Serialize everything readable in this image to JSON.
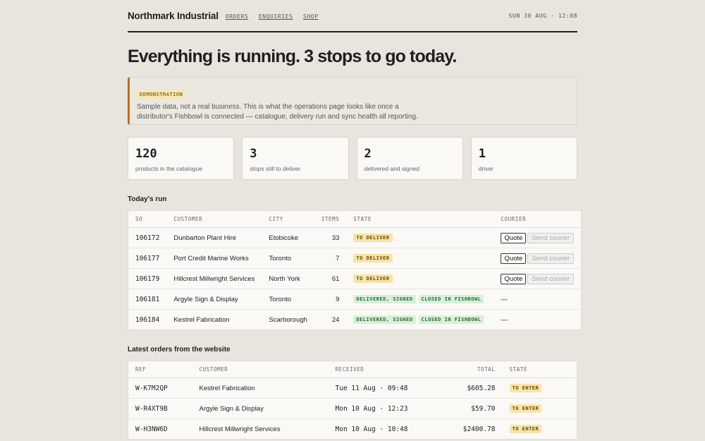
{
  "header": {
    "brand": "Northmark Industrial",
    "nav": [
      "ORDERS",
      "ENQUIRIES",
      "SHOP"
    ],
    "datetime": "SUN 30 AUG · 12:08"
  },
  "headline": "Everything is running. 3 stops to go today.",
  "demo": {
    "badge": "DEMONSTRATION",
    "text": "Sample data, not a real business. This is what the operations page looks like once a distributor's Fishbowl is connected — catalogue, delivery run and sync health all reporting."
  },
  "stats": [
    {
      "value": "120",
      "label": "products in the catalogue"
    },
    {
      "value": "3",
      "label": "stops still to deliver"
    },
    {
      "value": "2",
      "label": "delivered and signed"
    },
    {
      "value": "1",
      "label": "driver"
    }
  ],
  "run": {
    "title": "Today's run",
    "headers": [
      "SO",
      "CUSTOMER",
      "CITY",
      "ITEMS",
      "STATE",
      "COURIER"
    ],
    "quote_label": "Quote",
    "send_label": "Send courier",
    "dash": "—",
    "rows": [
      {
        "so": "106172",
        "customer": "Dunbarton Plant Hire",
        "city": "Etobicoke",
        "items": "33",
        "states": [
          "TO DELIVER"
        ],
        "courier": true
      },
      {
        "so": "106177",
        "customer": "Port Credit Marine Works",
        "city": "Toronto",
        "items": "7",
        "states": [
          "TO DELIVER"
        ],
        "courier": true
      },
      {
        "so": "106179",
        "customer": "Hillcrest Millwright Services",
        "city": "North York",
        "items": "61",
        "states": [
          "TO DELIVER"
        ],
        "courier": true
      },
      {
        "so": "106181",
        "customer": "Argyle Sign & Display",
        "city": "Toronto",
        "items": "9",
        "states": [
          "DELIVERED, SIGNED",
          "CLOSED IN FISHBOWL"
        ],
        "courier": false
      },
      {
        "so": "106184",
        "customer": "Kestrel Fabrication",
        "city": "Scarborough",
        "items": "24",
        "states": [
          "DELIVERED, SIGNED",
          "CLOSED IN FISHBOWL"
        ],
        "courier": false
      }
    ]
  },
  "orders": {
    "title": "Latest orders from the website",
    "headers": [
      "REF",
      "CUSTOMER",
      "RECEIVED",
      "TOTAL",
      "STATE"
    ],
    "rows": [
      {
        "ref": "W-K7M2QP",
        "customer": "Kestrel Fabrication",
        "received": "Tue 11 Aug · 09:48",
        "total": "$605.28",
        "state": "TO ENTER"
      },
      {
        "ref": "W-R4XT9B",
        "customer": "Argyle Sign & Display",
        "received": "Mon 10 Aug · 12:23",
        "total": "$59.70",
        "state": "TO ENTER"
      },
      {
        "ref": "W-H3NW6D",
        "customer": "Hillcrest Millwright Services",
        "received": "Mon 10 Aug · 10:48",
        "total": "$2400.78",
        "state": "TO ENTER"
      }
    ]
  },
  "colors": {
    "accent": "#c56a17",
    "amber_tag": "#f6e4a8",
    "green_tag": "#d9efd8",
    "background": "#e8e5de"
  }
}
